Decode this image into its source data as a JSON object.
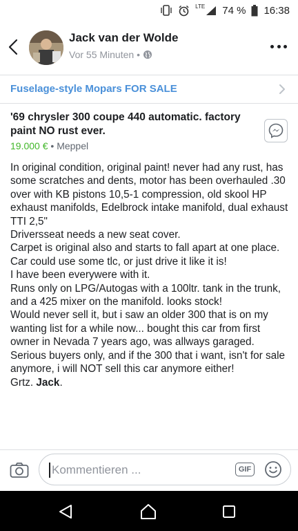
{
  "status_bar": {
    "network": "LTE",
    "battery": "74 %",
    "time": "16:38"
  },
  "post": {
    "author": "Jack van der Wolde",
    "time": "Vor 55 Minuten",
    "separator": "•"
  },
  "group": {
    "name": "Fuselage-style Mopars FOR SALE"
  },
  "listing": {
    "title": "'69 chrysler 300 coupe 440 automatic. factory paint NO rust ever.",
    "price": "19.000 €",
    "separator": " • ",
    "location": "Meppel"
  },
  "description": {
    "text": "In original condition, original paint! never had any rust, has some scratches and dents, motor has been overhauled .30 over with KB pistons 10,5-1 compression, old skool HP exhaust manifolds, Edelbrock intake manifold, dual exhaust TTI 2,5\"\nDriversseat needs a new seat cover.\nCarpet is original also and starts to fall apart at one place.\nCar could use some tlc, or just drive it like it is!\nI have been everywere with it.\nRuns only on LPG/Autogas with a 100ltr. tank in the trunk, and a 425 mixer on the manifold. looks stock!\nWould never sell it, but i saw an older 300 that is on my wanting list for a while now... bought this car from first owner in Nevada 7 years ago, was allways garaged.\nSerious buyers only, and if the 300 that i want, isn't for sale anymore, i will NOT sell this car anymore either!\nGrtz. ",
    "signature": "Jack",
    "signature_end": "."
  },
  "comment": {
    "placeholder": "Kommentieren ...",
    "gif_label": "GIF"
  },
  "icons": {
    "back": "chevron-left-icon",
    "globe": "globe-icon",
    "more": "more-dots-icon",
    "messenger": "messenger-icon",
    "camera": "camera-icon",
    "emoji": "emoji-icon"
  },
  "colors": {
    "group_link": "#4a90d9",
    "price": "#42b72a",
    "secondary_text": "#90949c",
    "navbar": "#000000"
  }
}
